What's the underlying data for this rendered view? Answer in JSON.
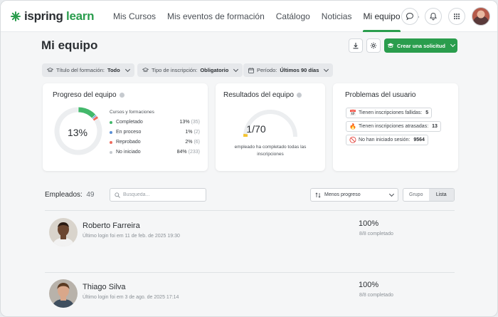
{
  "app": {
    "logo_word": "ispring",
    "logo_accent": "learn"
  },
  "nav": {
    "items": [
      "Mis Cursos",
      "Mis eventos de formación",
      "Catálogo",
      "Noticias",
      "Mi equipo"
    ],
    "active": "Mi equipo",
    "more": "···"
  },
  "header": {
    "title": "Mi equipo",
    "create_label": "Crear una solicitud"
  },
  "filters": [
    {
      "label": "Título del formación:",
      "value": "Todo"
    },
    {
      "label": "Tipo de inscripción:",
      "value": "Obligatorio"
    },
    {
      "label": "Período:",
      "value": "Últimos 90 días"
    }
  ],
  "progress_card": {
    "title": "Progreso del equipo",
    "center_value": "13%",
    "legend_title": "Cursos y formaciones",
    "items": [
      {
        "name": "Completado",
        "pct": "13%",
        "count": "(35)",
        "color": "#43b86b",
        "fraction": 0.13
      },
      {
        "name": "En proceso",
        "pct": "1%",
        "count": "(2)",
        "color": "#5b8fd6",
        "fraction": 0.01
      },
      {
        "name": "Reprobado",
        "pct": "2%",
        "count": "(6)",
        "color": "#ef6b5e",
        "fraction": 0.02
      },
      {
        "name": "No iniciado",
        "pct": "84%",
        "count": "(233)",
        "color": "#c6cacf",
        "fraction": 0.84
      }
    ]
  },
  "results_card": {
    "title": "Resultados del equipo",
    "value": "1/70",
    "fraction": 0.0143,
    "caption": "empleado ha completado todas las inscripciones",
    "accent": "#f4c430"
  },
  "problems_card": {
    "title": "Problemas del usuario",
    "items": [
      {
        "label": "Tienen inscripciones fallidas:",
        "count": "5",
        "icon": "calendar-x-icon"
      },
      {
        "label": "Tienen inscripciones atrasadas:",
        "count": "13",
        "icon": "fire-icon"
      },
      {
        "label": "No han iniciado sesión:",
        "count": "9564",
        "icon": "no-entry-icon"
      }
    ]
  },
  "employees": {
    "label": "Empleados:",
    "count": "49",
    "search_placeholder": "Busqueda...",
    "sort_label": "Menos progreso",
    "view_options": [
      "Grupo",
      "Lista"
    ],
    "active_view": "Lista",
    "rows": [
      {
        "name": "Roberto Farreira",
        "last_login": "Último login foi em 11 de feb. de 2025 19:30",
        "pct": "100%",
        "completed": "8/8 completado",
        "skin": "#6b4630",
        "bg": "#d9d4cc",
        "shirt": "#f2f2f2"
      },
      {
        "name": "Thiago Silva",
        "last_login": "Último login foi em 3 de ago. de 2025 17:14",
        "pct": "100%",
        "completed": "8/8 completado",
        "skin": "#d9a78a",
        "bg": "#b8b2aa",
        "shirt": "#3f4f5f"
      }
    ]
  }
}
